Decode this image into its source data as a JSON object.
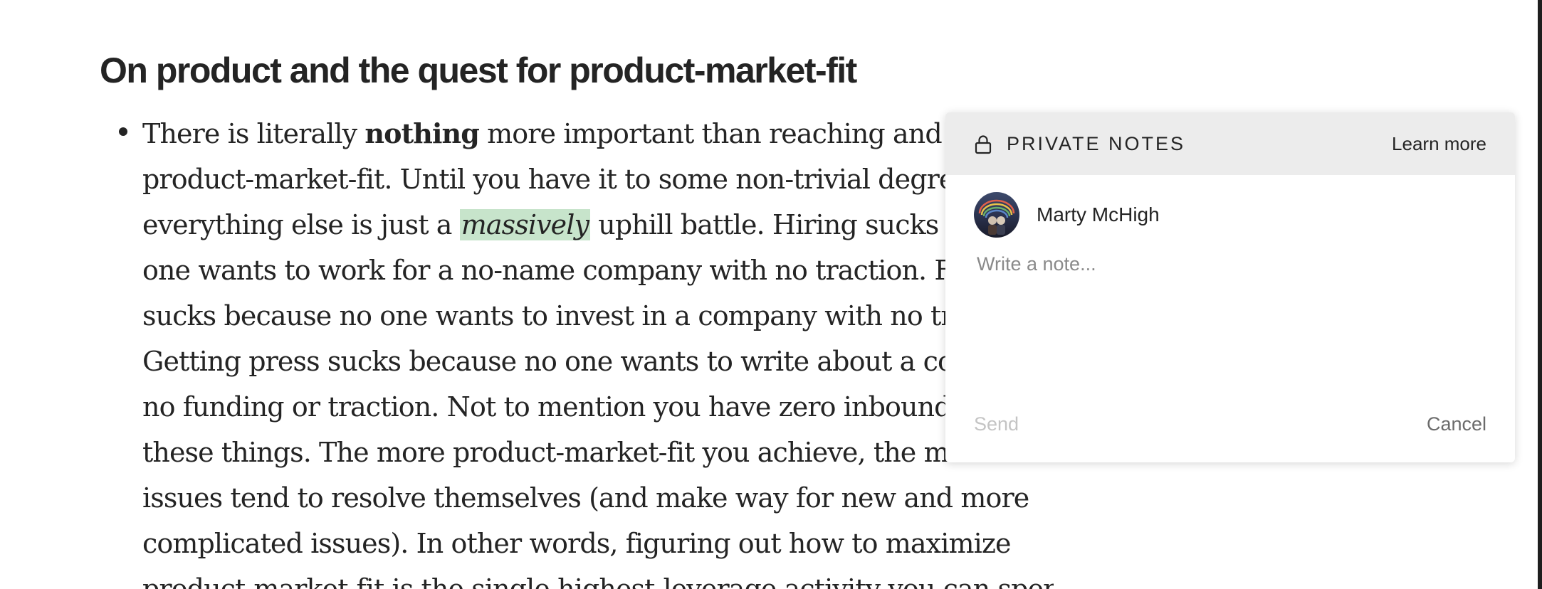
{
  "article": {
    "heading": "On product and the quest for product-market-fit",
    "lines": {
      "l1_a": "There is literally ",
      "l1_b": "nothing",
      "l1_c": " more important than reaching and ma",
      "l2": "product-market-fit. Until you have it to some non-trivial degree,",
      "l3_a": "everything else is just a ",
      "l3_b": "massively",
      "l3_c": " uphill battle. Hiring sucks beca",
      "l4": "one wants to work for a no-name company with no traction. Fur",
      "l5": "sucks because no one wants to invest in a company with no tract",
      "l6": "Getting press sucks because no one wants to write about a comp",
      "l7": "no funding or traction. Not to mention you have zero inbound fo",
      "l8": "these things. The more product-market-fit you achieve, the more",
      "l9": "issues tend to resolve themselves (and make way for new and more",
      "l10": "complicated issues). In other words, figuring out how to maximize",
      "l11": "product-market-fit is the single highest-leverage activity you can spend"
    }
  },
  "notes_panel": {
    "title": "PRIVATE NOTES",
    "learn_more": "Learn more",
    "author_name": "Marty McHigh",
    "input_placeholder": "Write a note...",
    "input_value": "",
    "send_label": "Send",
    "cancel_label": "Cancel",
    "icons": {
      "lock": "lock-icon",
      "avatar": "avatar"
    }
  },
  "colors": {
    "text": "#242424",
    "highlight": "#c7e4cb",
    "header_bg": "#ececec",
    "placeholder": "#8a8a8a",
    "send_disabled": "#c4c4c4",
    "cancel": "#6b6b6b"
  }
}
